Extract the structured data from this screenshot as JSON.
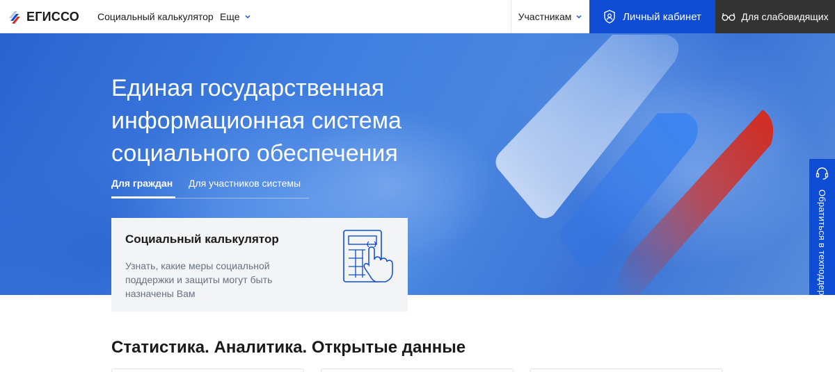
{
  "header": {
    "logo_text": "ЕГИССО",
    "nav": [
      {
        "label": "Социальный калькулятор"
      },
      {
        "label": "Еще"
      }
    ],
    "participants_label": "Участникам",
    "cabinet_label": "Личный кабинет",
    "low_vision_label": "Для слабовидящих"
  },
  "hero": {
    "title": "Единая государственная информационная система социального обеспечения",
    "tabs": [
      {
        "label": "Для граждан",
        "active": true
      },
      {
        "label": "Для участников системы",
        "active": false
      }
    ],
    "card": {
      "title": "Социальный калькулятор",
      "description": "Узнать, какие меры социальной поддержки и защиты могут быть назначены Вам",
      "icon": "calculator-hand-icon"
    }
  },
  "support": {
    "label": "Обратиться в техподдержку",
    "icon": "headset-icon"
  },
  "section": {
    "title": "Статистика. Аналитика. Открытые данные"
  },
  "colors": {
    "primary": "#0d4cd3",
    "dark": "#333333",
    "card_bg": "#f3f4f6",
    "logo_red": "#d52b1e"
  }
}
